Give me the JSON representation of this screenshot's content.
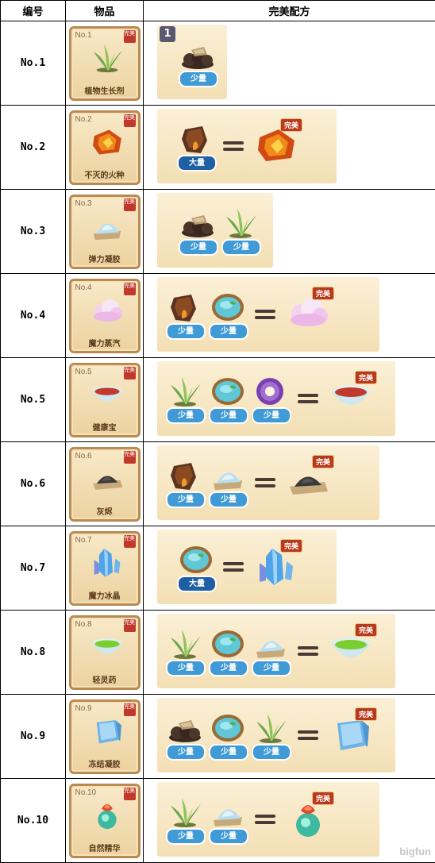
{
  "header": {
    "no": "编号",
    "item": "物品",
    "recipe": "完美配方"
  },
  "labels": {
    "perfect": "完美",
    "step": "1",
    "watermark": "bigfun"
  },
  "rows": [
    {
      "no": "No.1",
      "card_no": "No.1",
      "name": "植物生长剂",
      "badge": "完美"
    },
    {
      "no": "No.2",
      "card_no": "No.2",
      "name": "不灭的火种",
      "badge": "完美"
    },
    {
      "no": "No.3",
      "card_no": "No.3",
      "name": "弹力凝胶",
      "badge": "完美"
    },
    {
      "no": "No.4",
      "card_no": "No.4",
      "name": "魔力蒸汽",
      "badge": "完美"
    },
    {
      "no": "No.5",
      "card_no": "No.5",
      "name": "健康宝",
      "badge": "完美"
    },
    {
      "no": "No.6",
      "card_no": "No.6",
      "name": "灰烬",
      "badge": "完美"
    },
    {
      "no": "No.7",
      "card_no": "No.7",
      "name": "魔力冰晶",
      "badge": "完美"
    },
    {
      "no": "No.8",
      "card_no": "No.8",
      "name": "轻灵药",
      "badge": "完美"
    },
    {
      "no": "No.9",
      "card_no": "No.9",
      "name": "冻结凝胶",
      "badge": "完美"
    },
    {
      "no": "No.10",
      "card_no": "No.10",
      "name": "自然精华",
      "badge": "完美"
    }
  ],
  "recipes": [
    {
      "ingredients": [
        {
          "icon": "mushroom-pile",
          "amount": "少量"
        }
      ],
      "result": null,
      "step_badge": true
    },
    {
      "ingredients": [
        {
          "icon": "fire-rock",
          "amount": "大量"
        }
      ],
      "result": "fire-gem"
    },
    {
      "ingredients": [
        {
          "icon": "mushroom-pile",
          "amount": "少量"
        },
        {
          "icon": "grass",
          "amount": "少量"
        }
      ],
      "result": null
    },
    {
      "ingredients": [
        {
          "icon": "fire-rock",
          "amount": "少量"
        },
        {
          "icon": "water-bowl",
          "amount": "少量"
        }
      ],
      "result": "cloud"
    },
    {
      "ingredients": [
        {
          "icon": "grass",
          "amount": "少量"
        },
        {
          "icon": "water-bowl",
          "amount": "少量"
        },
        {
          "icon": "purple-ring",
          "amount": "少量"
        }
      ],
      "result": "red-bowl"
    },
    {
      "ingredients": [
        {
          "icon": "fire-rock",
          "amount": "少量"
        },
        {
          "icon": "salt-pile",
          "amount": "少量"
        }
      ],
      "result": "ash"
    },
    {
      "ingredients": [
        {
          "icon": "water-bowl",
          "amount": "大量"
        }
      ],
      "result": "crystal"
    },
    {
      "ingredients": [
        {
          "icon": "grass",
          "amount": "少量"
        },
        {
          "icon": "water-bowl",
          "amount": "少量"
        },
        {
          "icon": "salt-pile",
          "amount": "少量"
        }
      ],
      "result": "green-bowl"
    },
    {
      "ingredients": [
        {
          "icon": "mushroom-pile",
          "amount": "少量"
        },
        {
          "icon": "water-bowl",
          "amount": "少量"
        },
        {
          "icon": "grass",
          "amount": "少量"
        }
      ],
      "result": "ice-cube"
    },
    {
      "ingredients": [
        {
          "icon": "grass",
          "amount": "少量"
        },
        {
          "icon": "salt-pile",
          "amount": "少量"
        }
      ],
      "result": "nature-orb"
    }
  ],
  "colors": {
    "card_border": "#b98a52",
    "amount_small": "#3f9ad6",
    "amount_large": "#1f5fa3",
    "perfect_badge": "#b83a1d"
  }
}
